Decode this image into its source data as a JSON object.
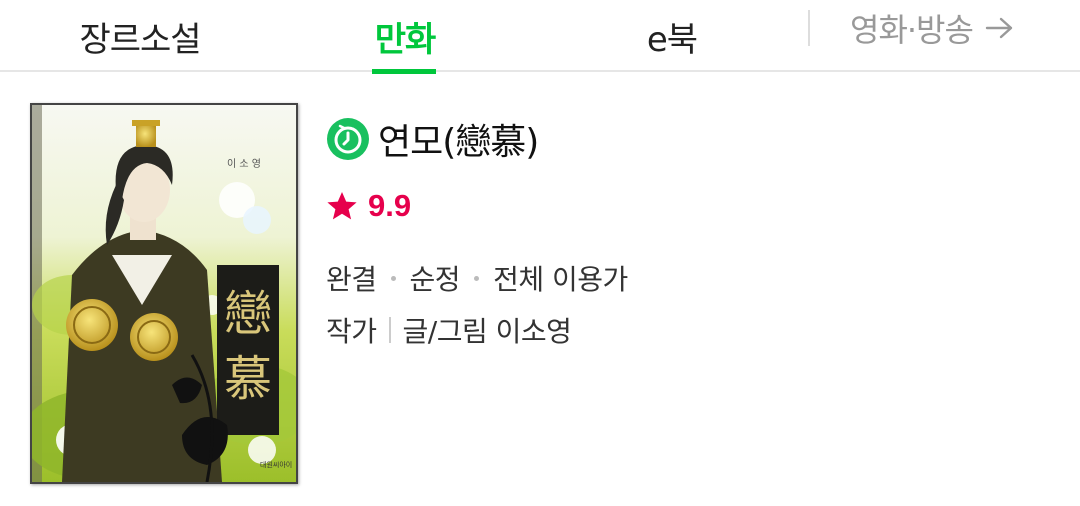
{
  "tabs": {
    "genre": "장르소설",
    "comic": "만화",
    "ebook": "e북",
    "movie": "영화·방송"
  },
  "book": {
    "title": "연모(戀慕)",
    "badge_icon": "clock-icon",
    "rating": "9.9",
    "rating_icon": "star-icon",
    "status": "완결",
    "genre": "순정",
    "age": "전체 이용가",
    "author_label": "작가",
    "author": "글/그림 이소영"
  },
  "colors": {
    "accent": "#00c73c",
    "rating": "#e6004c"
  }
}
